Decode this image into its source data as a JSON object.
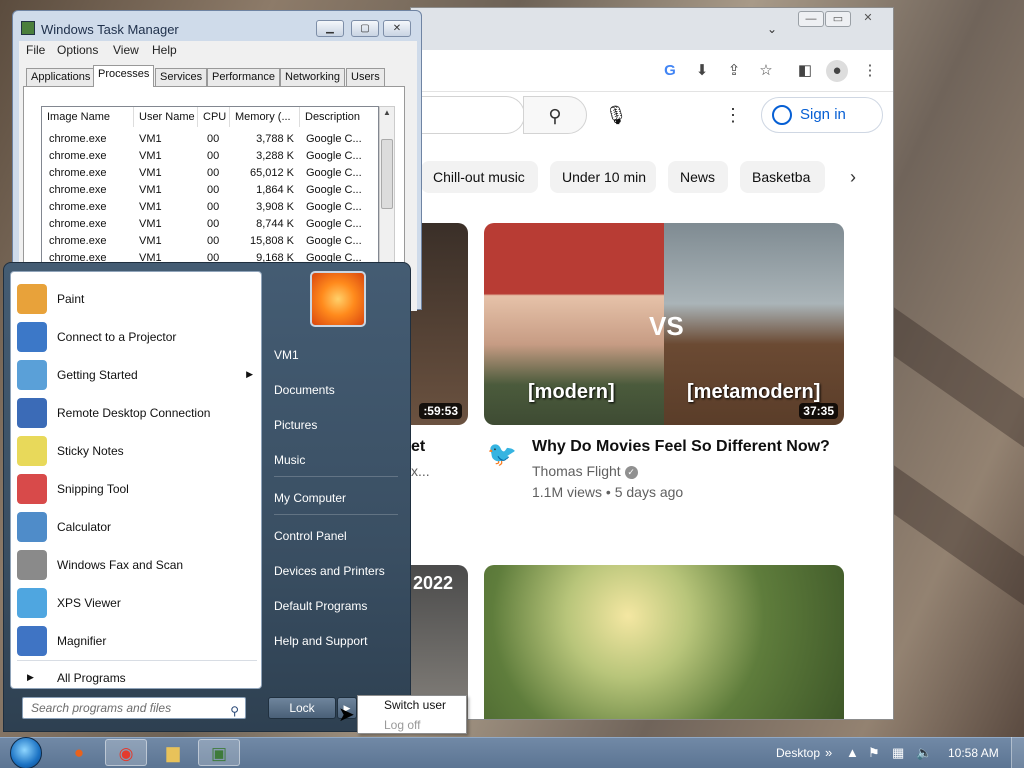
{
  "taskmgr": {
    "title": "Windows Task Manager",
    "menu": [
      "File",
      "Options",
      "View",
      "Help"
    ],
    "tabs": [
      "Applications",
      "Processes",
      "Services",
      "Performance",
      "Networking",
      "Users"
    ],
    "columns": [
      "Image Name",
      "User Name",
      "CPU",
      "Memory (...",
      "Description"
    ],
    "rows": [
      [
        "chrome.exe",
        "VM1",
        "00",
        "3,788 K",
        "Google C..."
      ],
      [
        "chrome.exe",
        "VM1",
        "00",
        "3,288 K",
        "Google C..."
      ],
      [
        "chrome.exe",
        "VM1",
        "00",
        "65,012 K",
        "Google C..."
      ],
      [
        "chrome.exe",
        "VM1",
        "00",
        "1,864 K",
        "Google C..."
      ],
      [
        "chrome.exe",
        "VM1",
        "00",
        "3,908 K",
        "Google C..."
      ],
      [
        "chrome.exe",
        "VM1",
        "00",
        "8,744 K",
        "Google C..."
      ],
      [
        "chrome.exe",
        "VM1",
        "00",
        "15,808 K",
        "Google C..."
      ],
      [
        "chrome.exe",
        "VM1",
        "00",
        "9,168 K",
        "Google C..."
      ]
    ]
  },
  "youtube": {
    "sign_in": "Sign in",
    "chips": [
      "Chill-out music",
      "Under 10 min",
      "News",
      "Basketba"
    ],
    "video": {
      "title": "Why Do Movies Feel So Different Now?",
      "channel": "Thomas Flight",
      "meta": "1.1M views • 5 days ago",
      "duration": "37:35",
      "label_left": "[modern]",
      "label_right": "[metamodern]",
      "vs": "VS"
    },
    "partial_duration": ":59:53",
    "partial_title": "et",
    "partial_sub": "x...",
    "partial_year": "2022"
  },
  "startmenu": {
    "programs": [
      {
        "label": "Paint",
        "icon": "paint-icon",
        "color": "#e8a23a"
      },
      {
        "label": "Connect to a Projector",
        "icon": "projector-icon",
        "color": "#3c78c8"
      },
      {
        "label": "Getting Started",
        "icon": "getting-started-icon",
        "color": "#5aa0d8"
      },
      {
        "label": "Remote Desktop Connection",
        "icon": "remote-desktop-icon",
        "color": "#3b6bb7"
      },
      {
        "label": "Sticky Notes",
        "icon": "sticky-notes-icon",
        "color": "#e8d95a"
      },
      {
        "label": "Snipping Tool",
        "icon": "snipping-tool-icon",
        "color": "#d84a4a"
      },
      {
        "label": "Calculator",
        "icon": "calculator-icon",
        "color": "#4f8cc9"
      },
      {
        "label": "Windows Fax and Scan",
        "icon": "fax-scan-icon",
        "color": "#8a8a8a"
      },
      {
        "label": "XPS Viewer",
        "icon": "xps-viewer-icon",
        "color": "#4fa6e0"
      },
      {
        "label": "Magnifier",
        "icon": "magnifier-icon",
        "color": "#3f74c4"
      }
    ],
    "all_programs": "All Programs",
    "search_placeholder": "Search programs and files",
    "right": [
      "VM1",
      "Documents",
      "Pictures",
      "Music",
      "My Computer",
      "Control Panel",
      "Devices and Printers",
      "Default Programs",
      "Help and Support"
    ],
    "lock": "Lock",
    "popup": [
      "Switch user",
      "Log off"
    ]
  },
  "taskbar": {
    "desktop": "Desktop",
    "clock": "10:58 AM"
  }
}
